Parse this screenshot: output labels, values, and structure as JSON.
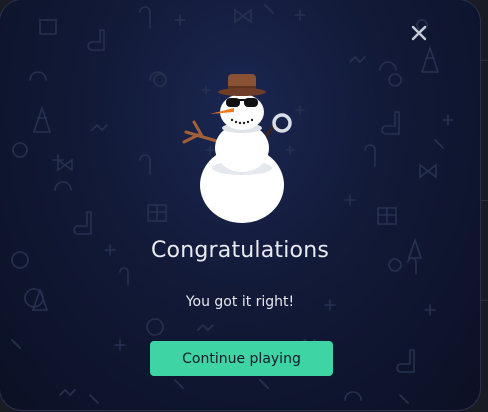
{
  "modal": {
    "title": "Congratulations",
    "message": "You got it right!",
    "continue_label": "Continue playing",
    "close_icon": "close-icon",
    "illustration": "snowman-with-hat-and-sunglasses"
  },
  "colors": {
    "accent": "#3fd4a3",
    "modal_background": "#121a38",
    "text": "#e9ebf2"
  }
}
